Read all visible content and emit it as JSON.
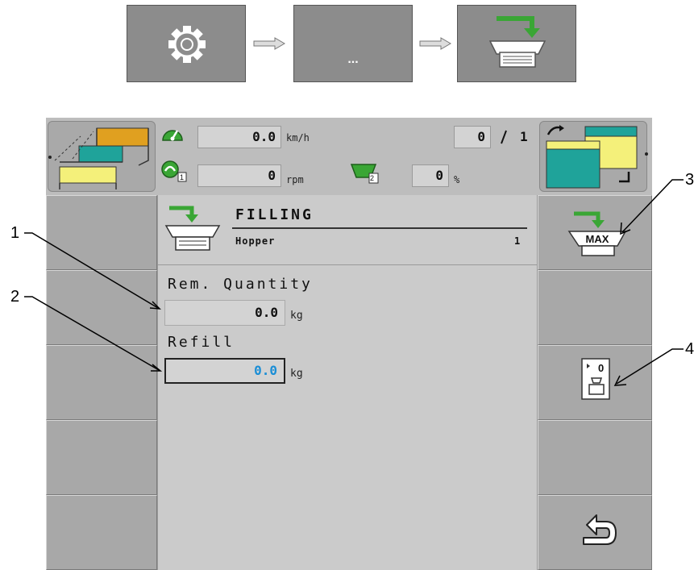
{
  "navigation": {
    "steps": [
      {
        "icon": "gear-icon"
      },
      {
        "label": "..."
      },
      {
        "icon": "hopper-filling-icon"
      }
    ]
  },
  "status_bar": {
    "speed_value": "0.0",
    "speed_unit": "km/h",
    "rpm_value": "0",
    "rpm_unit": "rpm",
    "pto_index": "1",
    "counter_left": "0",
    "counter_right": "1",
    "hopper_index": "2",
    "fill_percent": "0",
    "fill_unit": "%"
  },
  "panel": {
    "title": "FILLING",
    "subtitle": "Hopper",
    "hopper_number": "1"
  },
  "fields": {
    "rem_quantity_label": "Rem. Quantity",
    "rem_quantity_value": "0.0",
    "rem_quantity_unit": "kg",
    "refill_label": "Refill",
    "refill_value": "0.0",
    "refill_unit": "kg"
  },
  "softkeys": {
    "max_label": "MAX",
    "tare_label": "0"
  },
  "callouts": [
    "1",
    "2",
    "3",
    "4"
  ],
  "colors": {
    "accent_green": "#3aa635",
    "value_blue": "#1a8ed6",
    "teal": "#1fa39a",
    "yellow": "#f4f07a",
    "orange": "#e0a020"
  }
}
